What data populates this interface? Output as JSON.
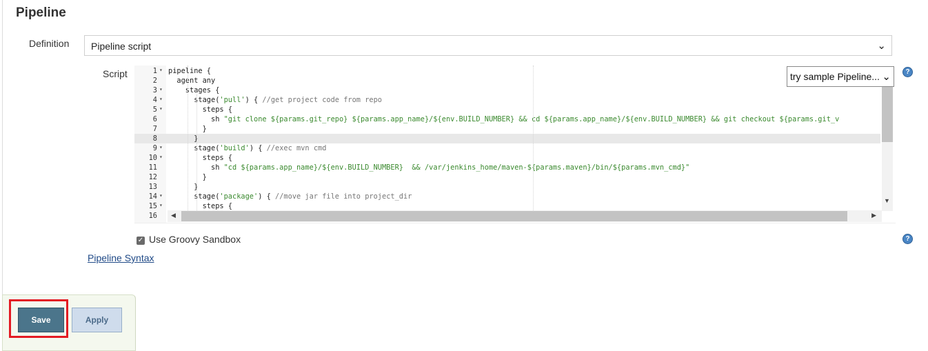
{
  "section": {
    "title": "Pipeline"
  },
  "definition": {
    "label": "Definition",
    "value": "Pipeline script"
  },
  "script": {
    "label": "Script",
    "sample_select": "try sample Pipeline...",
    "lines": [
      {
        "n": "1",
        "fold": true,
        "parts": [
          {
            "t": "pipeline {"
          }
        ]
      },
      {
        "n": "2",
        "fold": false,
        "parts": [
          {
            "t": "  agent any"
          }
        ]
      },
      {
        "n": "3",
        "fold": true,
        "parts": [
          {
            "t": "    stages {"
          }
        ]
      },
      {
        "n": "4",
        "fold": true,
        "parts": [
          {
            "t": "      stage("
          },
          {
            "t": "'pull'",
            "c": "str"
          },
          {
            "t": ") { "
          },
          {
            "t": "//get project code from repo",
            "c": "cmt"
          }
        ]
      },
      {
        "n": "5",
        "fold": true,
        "parts": [
          {
            "t": "        steps {"
          }
        ]
      },
      {
        "n": "6",
        "fold": false,
        "parts": [
          {
            "t": "          sh "
          },
          {
            "t": "\"git clone ${params.git_repo} ${params.app_name}/${env.BUILD_NUMBER} && cd ${params.app_name}/${env.BUILD_NUMBER} && git checkout ${params.git_v",
            "c": "str"
          }
        ]
      },
      {
        "n": "7",
        "fold": false,
        "parts": [
          {
            "t": "        }"
          }
        ]
      },
      {
        "n": "8",
        "fold": false,
        "active": true,
        "parts": [
          {
            "t": "      }"
          }
        ]
      },
      {
        "n": "9",
        "fold": true,
        "parts": [
          {
            "t": "      stage("
          },
          {
            "t": "'build'",
            "c": "str"
          },
          {
            "t": ") { "
          },
          {
            "t": "//exec mvn cmd",
            "c": "cmt"
          }
        ]
      },
      {
        "n": "10",
        "fold": true,
        "parts": [
          {
            "t": "        steps {"
          }
        ]
      },
      {
        "n": "11",
        "fold": false,
        "parts": [
          {
            "t": "          sh "
          },
          {
            "t": "\"cd ${params.app_name}/${env.BUILD_NUMBER}  && /var/jenkins_home/maven-${params.maven}/bin/${params.mvn_cmd}\"",
            "c": "str"
          }
        ]
      },
      {
        "n": "12",
        "fold": false,
        "parts": [
          {
            "t": "        }"
          }
        ]
      },
      {
        "n": "13",
        "fold": false,
        "parts": [
          {
            "t": "      }"
          }
        ]
      },
      {
        "n": "14",
        "fold": true,
        "parts": [
          {
            "t": "      stage("
          },
          {
            "t": "'package'",
            "c": "str"
          },
          {
            "t": ") { "
          },
          {
            "t": "//move jar file into project_dir",
            "c": "cmt"
          }
        ]
      },
      {
        "n": "15",
        "fold": true,
        "parts": [
          {
            "t": "        steps {"
          }
        ]
      },
      {
        "n": "16",
        "fold": false,
        "parts": [
          {
            "t": ""
          }
        ]
      }
    ]
  },
  "sandbox": {
    "label": "Use Groovy Sandbox",
    "checked": true
  },
  "links": {
    "pipeline_syntax": "Pipeline Syntax"
  },
  "buttons": {
    "save": "Save",
    "apply": "Apply"
  },
  "colors": {
    "save_bg": "#4b758b",
    "highlight": "#e31b23",
    "string": "#3b8a2f",
    "comment": "#777777"
  }
}
